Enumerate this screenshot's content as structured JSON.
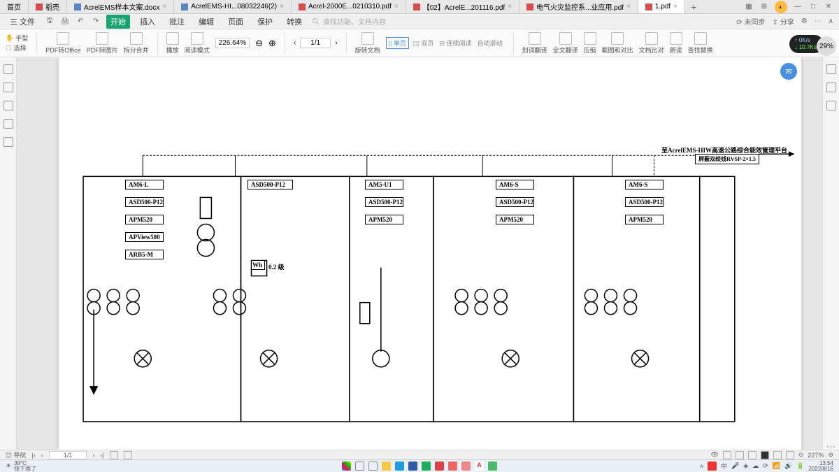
{
  "tabs": [
    {
      "label": "首页",
      "icon": ""
    },
    {
      "label": "稻壳",
      "icon": "red"
    },
    {
      "label": "AcrelEMS样本文案.docx",
      "icon": "blue"
    },
    {
      "label": "AcrelEMS-HI...08032246(2)",
      "icon": "blue"
    },
    {
      "label": "Acrel-2000E...0210310.pdf",
      "icon": "red"
    },
    {
      "label": "【02】AcrelE...201116.pdf",
      "icon": "red"
    },
    {
      "label": "电气火灾监控系...业应用.pdf",
      "icon": "red"
    },
    {
      "label": "1.pdf",
      "icon": "red",
      "active": true
    }
  ],
  "menu": {
    "file": "三 文件",
    "items": [
      "开始",
      "插入",
      "批注",
      "编辑",
      "页面",
      "保护",
      "转换"
    ],
    "search_ph": "查找功能、文档内容",
    "right": [
      "未同步",
      "分享"
    ]
  },
  "toolbar": {
    "hand": "手型",
    "select": "选择",
    "pdf2office": "PDF转Office",
    "pdf2pic": "PDF转图片",
    "split": "拆分合并",
    "play": "播放",
    "readmode": "阅读模式",
    "zoom": "226.64%",
    "page_cur": "1",
    "page_tot": "1",
    "rotate": "旋转文档",
    "single": "单页",
    "double": "双页",
    "cont": "连续阅读",
    "autoscroll": "自动滚动",
    "divide_trans": "划词翻译",
    "fulltrans": "全文翻译",
    "compress": "压缩",
    "crop": "截图和对比",
    "docdiff": "文档比对",
    "read": "朗读",
    "findrep": "查找替换"
  },
  "status": {
    "nav": "导航",
    "page": "1/1",
    "zoom": "227%"
  },
  "taskbar": {
    "temp": "39°C",
    "weather": "快下雨了",
    "time": "13:54",
    "date": "2022/8/16"
  },
  "speed": {
    "up": "0K/s",
    "down": "10.7K/s",
    "big": "29%"
  },
  "diagram": {
    "platform": "至AcrelEMS-HIW高速公路综合能效管理平台",
    "cable": "屏蔽双绞线RVSP-2×1.5",
    "level": "0.2 级",
    "wh": "Wh",
    "bays": [
      {
        "title": "AM6-L",
        "items": [
          "ASD500-P12",
          "APM520",
          "APView500",
          "ARB5-M"
        ]
      },
      {
        "title": "ASD500-P12",
        "items": []
      },
      {
        "title": "AM5-U1",
        "items": [
          "ASD500-P12",
          "APM520"
        ]
      },
      {
        "title": "AM6-S",
        "items": [
          "ASD500-P12",
          "APM520"
        ]
      },
      {
        "title": "AM6-S",
        "items": [
          "ASD500-P12",
          "APM520"
        ]
      }
    ]
  }
}
